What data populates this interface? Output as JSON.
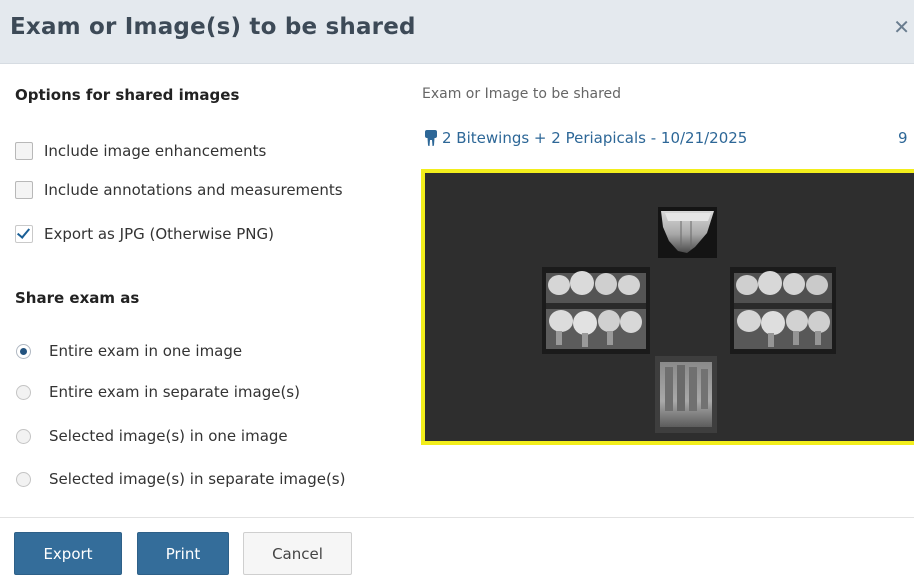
{
  "dialog": {
    "title": "Exam or Image(s) to be shared",
    "close_glyph": "✕"
  },
  "options": {
    "heading": "Options for shared images",
    "items": [
      {
        "label": "Include image enhancements",
        "checked": false
      },
      {
        "label": "Include annotations and measurements",
        "checked": false
      },
      {
        "label": "Export as JPG (Otherwise PNG)",
        "checked": true
      }
    ]
  },
  "share_as": {
    "heading": "Share exam as",
    "items": [
      {
        "label": "Entire exam in one image",
        "selected": true
      },
      {
        "label": "Entire exam in separate image(s)",
        "selected": false
      },
      {
        "label": "Selected image(s) in one image",
        "selected": false
      },
      {
        "label": "Selected image(s) in separate image(s)",
        "selected": false
      }
    ]
  },
  "exam_panel": {
    "heading": "Exam or Image to be shared",
    "exam_label": "2 Bitewings + 2 Periapicals - 10/21/2025",
    "exam_count": "9",
    "icon": "tooth-icon"
  },
  "preview": {
    "border_color": "#f2ee1c",
    "images": [
      "periapical-top",
      "bitewing-left",
      "bitewing-right",
      "periapical-bottom"
    ]
  },
  "footer": {
    "export_label": "Export",
    "print_label": "Print",
    "cancel_label": "Cancel"
  },
  "colors": {
    "primary": "#346d9a",
    "link": "#2d6797",
    "title_bar": "#e4e9ee"
  }
}
